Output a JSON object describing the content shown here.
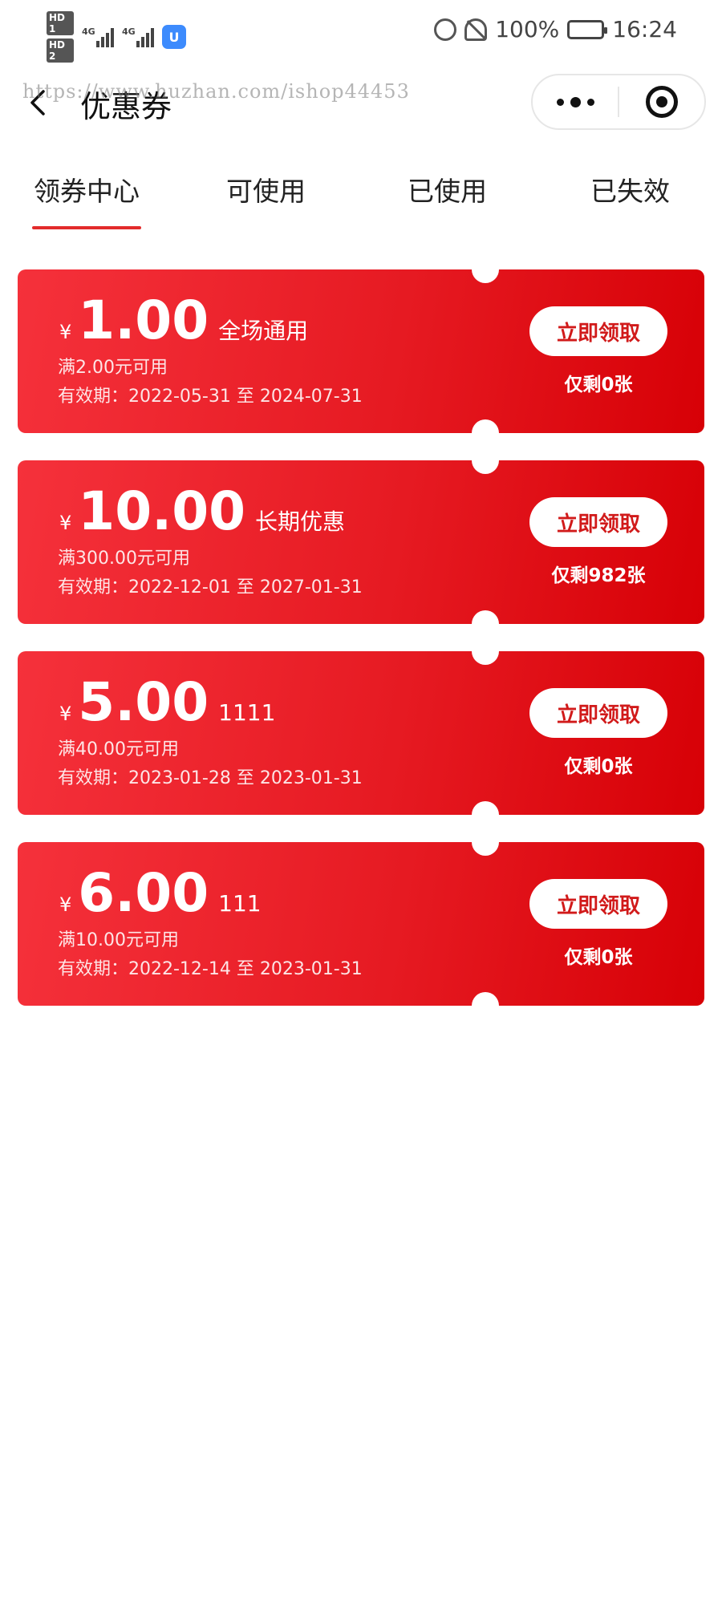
{
  "status_bar": {
    "sim1": "HD 1",
    "sim2": "HD 2",
    "net1": "4G",
    "net2": "4G",
    "app_badge": "U",
    "battery": "100%",
    "time": "16:24"
  },
  "nav": {
    "title": "优惠券",
    "watermark": "https://www.huzhan.com/ishop44453"
  },
  "tabs": [
    {
      "label": "领券中心",
      "active": true
    },
    {
      "label": "可使用",
      "active": false
    },
    {
      "label": "已使用",
      "active": false
    },
    {
      "label": "已失效",
      "active": false
    }
  ],
  "coupons": [
    {
      "currency": "¥",
      "value": "1.00",
      "name": "全场通用",
      "condition": "满2.00元可用",
      "validity": "有效期：2022-05-31 至 2024-07-31",
      "button": "立即领取",
      "remaining": "仅剩0张"
    },
    {
      "currency": "¥",
      "value": "10.00",
      "name": "长期优惠",
      "condition": "满300.00元可用",
      "validity": "有效期：2022-12-01 至 2027-01-31",
      "button": "立即领取",
      "remaining": "仅剩982张"
    },
    {
      "currency": "¥",
      "value": "5.00",
      "name": "1111",
      "condition": "满40.00元可用",
      "validity": "有效期：2023-01-28 至 2023-01-31",
      "button": "立即领取",
      "remaining": "仅剩0张"
    },
    {
      "currency": "¥",
      "value": "6.00",
      "name": "111",
      "condition": "满10.00元可用",
      "validity": "有效期：2022-12-14 至 2023-01-31",
      "button": "立即领取",
      "remaining": "仅剩0张"
    }
  ],
  "colors": {
    "coupon_gradient_start": "#f5313b",
    "coupon_gradient_end": "#d70006",
    "tab_indicator": "#e32b2b",
    "button_text": "#d11a1a"
  }
}
